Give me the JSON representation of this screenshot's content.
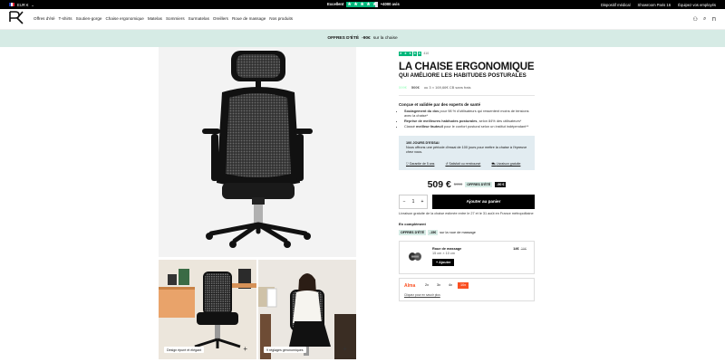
{
  "topbar": {
    "currency": "EUR €",
    "rating_word": "Excellent",
    "reviews": "+4000 avis",
    "links": [
      "Dispositif médical",
      "Showroom Paris 16",
      "Équipez vos employés"
    ]
  },
  "nav": {
    "logo_text": "PERCKO",
    "menu": [
      "Offres d'été",
      "T-shirts",
      "Soutien-gorge",
      "Chaise ergonomique",
      "Matelas",
      "Sommiers",
      "Surmatelas",
      "Oreillers",
      "Roue de massage",
      "Nos produits"
    ]
  },
  "promo": {
    "bold": "OFFRES D'ÉTÉ",
    "amount": "-90€",
    "rest": "sur la chaise"
  },
  "gallery": {
    "captions": [
      "Design épuré et élégant",
      "9 réglages géronomiques"
    ]
  },
  "product": {
    "review_count": "410",
    "title": "LA CHAISE ERGONOMIQUE",
    "subtitle": "QUI AMÉLIORE LES HABITUDES POSTURALES",
    "pay_a": "599€",
    "pay_b": "500€",
    "pay_c": "ou 3 × 169,66€ CB sans frais",
    "designed_heading": "Conçue et validée par des experts de santé",
    "bullets": [
      {
        "bold": "Soulagement du dos",
        "rest": " pour 98 % d'utilisateurs qui ressentent moins de tensions avec la chaise*"
      },
      {
        "bold": "Reprise de meilleures habitudes posturales",
        "rest": ", selon 84% des utilisateurs*"
      },
      {
        "bold": "meilleur fauteuil",
        "pre": "Classé ",
        "rest": " pour le confort postural selon un institut indépendant**"
      }
    ],
    "trial_heading": "100 JOURS D'ESSAI",
    "trial_text": "Nous offrons une période d'essai de 100 jours pour mettre la chaise à l'épreuve chez vous.",
    "trial_links": [
      "Garantie de 5 ans",
      "Satisfait ou remboursé",
      "Livraison gratuite"
    ],
    "price": "509 €",
    "old_price": "599€",
    "tag_offer": "OFFRES D'ÉTÉ",
    "tag_discount": "-90 €",
    "qty": "1",
    "add_to_cart": "Ajouter au panier",
    "delivery": "Livraison gratuite de la chaise estimée entre le 27 et le 31 août en France métropolitaine",
    "complement_heading": "En complément",
    "compl_offer": "OFFRES D'ÉTÉ",
    "compl_discount": "-15€",
    "compl_rest": "sur la roue de massage"
  },
  "upsell": {
    "name": "Roue de massage",
    "dims": "15 cm × 10 cm",
    "button": "+ Ajouter",
    "price": "14€",
    "old": "29€"
  },
  "alma": {
    "logo": "Alma",
    "options": [
      "2x",
      "3x",
      "4x",
      "10x"
    ],
    "selected": "10x",
    "link": "Cliquez pour en savoir plus"
  },
  "colors": {
    "accent": "#d6ebe5",
    "trust": "#00b67a",
    "alma": "#fa5022"
  }
}
